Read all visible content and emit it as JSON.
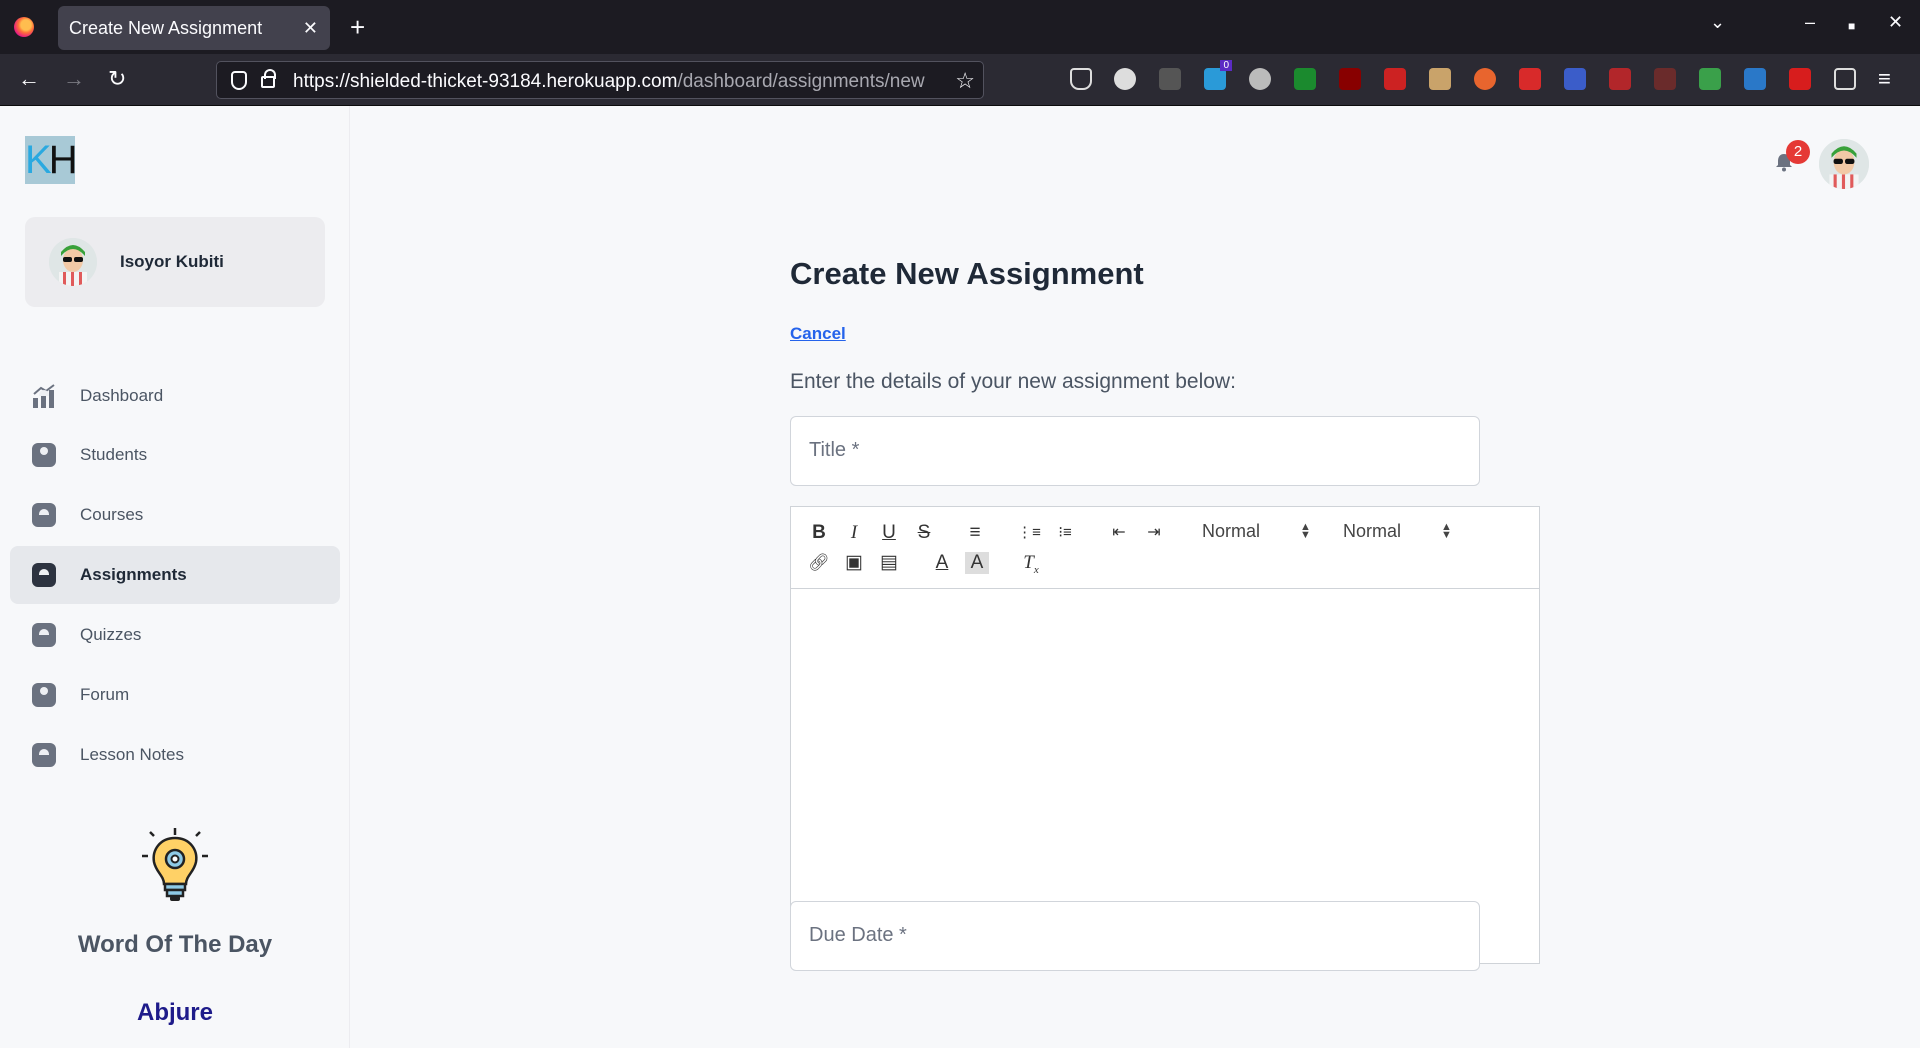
{
  "browser": {
    "tab_title": "Create New Assignment",
    "tab_close": "✕",
    "new_tab": "+",
    "url_host": "https://shielded-thicket-93184.herokuapp.com",
    "url_path": "/dashboard/assignments/new",
    "ext_badge_count": "0"
  },
  "sidebar": {
    "user_name": "Isoyor Kubiti",
    "items": [
      {
        "label": "Dashboard",
        "icon": "chart-icon"
      },
      {
        "label": "Students",
        "icon": "person-icon"
      },
      {
        "label": "Courses",
        "icon": "book-icon"
      },
      {
        "label": "Assignments",
        "icon": "book-icon",
        "active": true
      },
      {
        "label": "Quizzes",
        "icon": "book-icon"
      },
      {
        "label": "Forum",
        "icon": "person-icon"
      },
      {
        "label": "Lesson Notes",
        "icon": "book-icon"
      }
    ],
    "word_of_day_title": "Word Of The Day",
    "word_of_day": "Abjure"
  },
  "header": {
    "notification_count": "2"
  },
  "main": {
    "title": "Create New Assignment",
    "cancel_label": "Cancel",
    "intro": "Enter the details of your new assignment below:",
    "title_field_label": "Title *",
    "due_date_label": "Due Date *",
    "editor": {
      "header_select": "Normal",
      "size_select": "Normal"
    }
  },
  "colors": {
    "accent_link": "#2563eb",
    "word_of_day": "#1e1b8a",
    "badge": "#e53935"
  }
}
